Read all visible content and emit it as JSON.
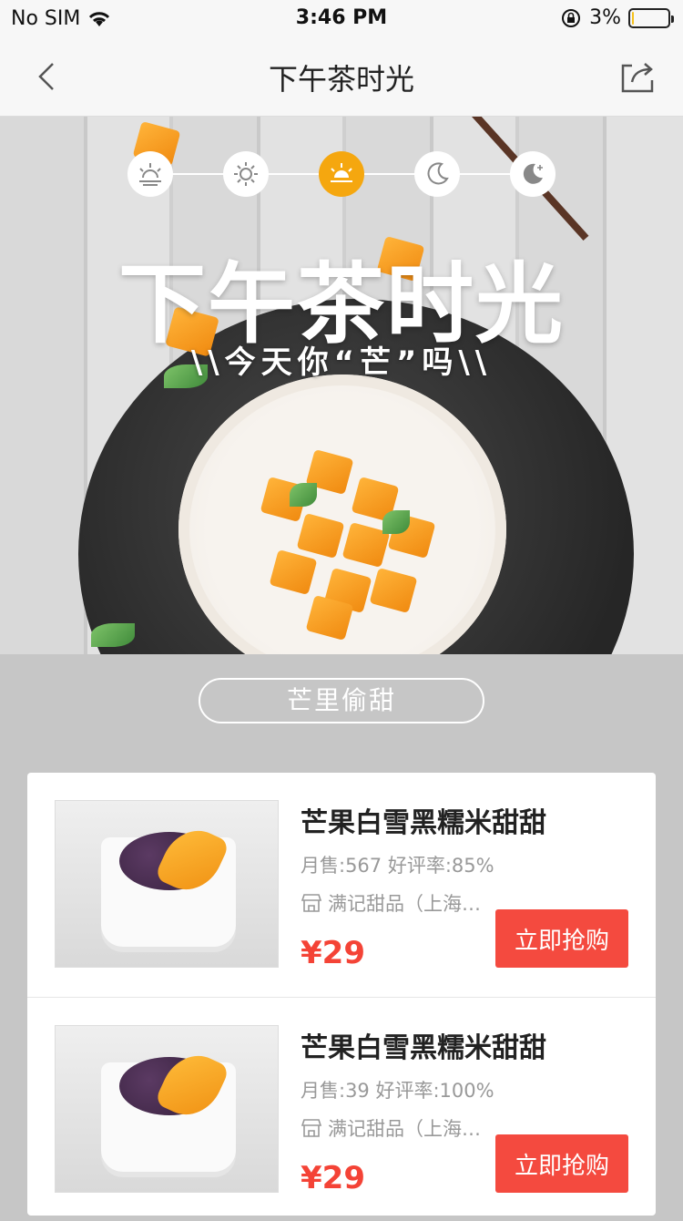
{
  "status_bar": {
    "carrier": "No SIM",
    "time": "3:46 PM",
    "battery": "3%",
    "battery_level": 0.03
  },
  "navbar": {
    "title": "下午茶时光"
  },
  "hero": {
    "title": "下午茶时光",
    "subtitle": "\\\\今天你“芒”吗\\\\",
    "timeline": [
      {
        "icon": "sunrise-icon",
        "active": false
      },
      {
        "icon": "sun-icon",
        "active": false
      },
      {
        "icon": "sunset-icon",
        "active": true
      },
      {
        "icon": "moon-icon",
        "active": false
      },
      {
        "icon": "night-moon-icon",
        "active": false
      }
    ],
    "accent": "#f5a70f"
  },
  "section": {
    "title": "芒里偷甜"
  },
  "products": [
    {
      "name": "芒果白雪黑糯米甜甜",
      "meta": "月售:567 好评率:85%",
      "shop": "满记甜品（上海…",
      "price": "¥29",
      "button": "立即抢购"
    },
    {
      "name": "芒果白雪黑糯米甜甜",
      "meta": "月售:39 好评率:100%",
      "shop": "满记甜品（上海…",
      "price": "¥29",
      "button": "立即抢购"
    }
  ],
  "colors": {
    "price": "#f44336",
    "button": "#f44a3f"
  }
}
